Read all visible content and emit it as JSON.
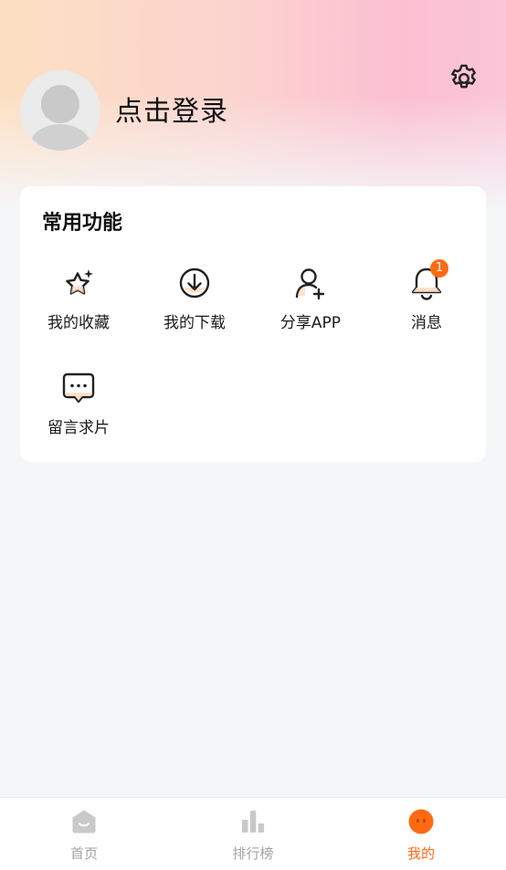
{
  "profile": {
    "login_text": "点击登录"
  },
  "functions": {
    "title": "常用功能",
    "items": [
      {
        "label": "我的收藏",
        "icon": "star-sparkle-icon"
      },
      {
        "label": "我的下载",
        "icon": "download-icon"
      },
      {
        "label": "分享APP",
        "icon": "user-add-icon"
      },
      {
        "label": "消息",
        "icon": "bell-icon",
        "badge": "1"
      },
      {
        "label": "留言求片",
        "icon": "message-icon"
      }
    ]
  },
  "tabbar": {
    "tabs": [
      {
        "label": "首页",
        "icon": "home-icon",
        "active": false
      },
      {
        "label": "排行榜",
        "icon": "chart-icon",
        "active": false
      },
      {
        "label": "我的",
        "icon": "profile-face-icon",
        "active": true
      }
    ]
  },
  "colors": {
    "accent": "#ff6a13",
    "inactive": "#a3a3a3",
    "header_gradient": [
      "#fde0c2",
      "#fbbfd2"
    ]
  }
}
